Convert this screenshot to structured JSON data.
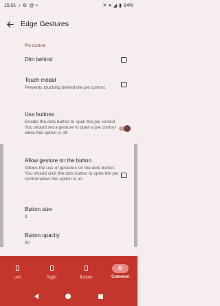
{
  "statusbar": {
    "time": "15:01",
    "battery": "64%"
  },
  "appbar": {
    "title": "Edge Gestures"
  },
  "section": {
    "header": "Pie control"
  },
  "prefs": [
    {
      "title": "Dim behind",
      "summary": "",
      "control": "checkbox",
      "checked": false
    },
    {
      "title": "Touch modal",
      "summary": "Prevents touching behind the pie control.",
      "control": "checkbox",
      "checked": false
    },
    {
      "title": "Use buttons",
      "summary": "Enable the dots button to open the pie control. You should set a gesture to open a pie control while this option is off.",
      "control": "switch",
      "checked": true
    },
    {
      "title": "Allow gesture on the button",
      "summary": "Allows the use of gestures on the dots button. You should click the dots button to open the pie control when this option is on.",
      "control": "checkbox",
      "checked": false
    },
    {
      "title": "Button size",
      "summary": "3",
      "control": "none"
    },
    {
      "title": "Button opacity",
      "summary": "30",
      "control": "none"
    }
  ],
  "bottomnav": {
    "items": [
      {
        "label": "Left",
        "icon": "phone-left-icon",
        "active": false
      },
      {
        "label": "Right",
        "icon": "phone-right-icon",
        "active": false
      },
      {
        "label": "Bottom",
        "icon": "phone-bottom-icon",
        "active": false
      },
      {
        "label": "Common",
        "icon": "gear-icon",
        "active": true
      }
    ]
  },
  "colors": {
    "accent": "#c4352c",
    "switch_thumb": "#7a3e3a",
    "section_header": "#8a2a22",
    "background": "#f6eeee"
  }
}
